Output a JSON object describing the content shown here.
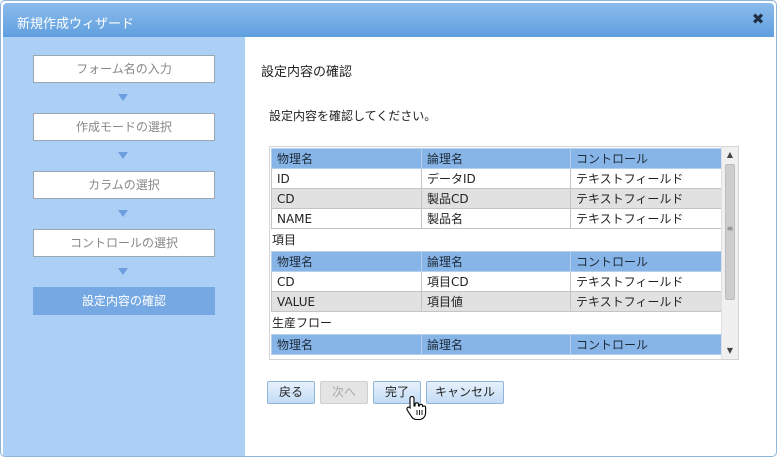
{
  "dialog": {
    "title": "新規作成ウィザード",
    "close_glyph": "✖"
  },
  "steps": [
    {
      "label": "フォーム名の入力",
      "active": false
    },
    {
      "label": "作成モードの選択",
      "active": false
    },
    {
      "label": "カラムの選択",
      "active": false
    },
    {
      "label": "コントロールの選択",
      "active": false
    },
    {
      "label": "設定内容の確認",
      "active": true
    }
  ],
  "main": {
    "heading": "設定内容の確認",
    "instruction": "設定内容を確認してください。"
  },
  "columns": [
    "物理名",
    "論理名",
    "コントロール"
  ],
  "groups": [
    {
      "label": "",
      "rows": [
        [
          "ID",
          "データID",
          "テキストフィールド"
        ],
        [
          "CD",
          "製品CD",
          "テキストフィールド"
        ],
        [
          "NAME",
          "製品名",
          "テキストフィールド"
        ]
      ]
    },
    {
      "label": "項目",
      "rows": [
        [
          "CD",
          "項目CD",
          "テキストフィールド"
        ],
        [
          "VALUE",
          "項目値",
          "テキストフィールド"
        ]
      ]
    },
    {
      "label": "生産フロー",
      "rows": []
    }
  ],
  "scrollbar": {
    "up_glyph": "▲",
    "down_glyph": "▼",
    "grip_glyph": "≡"
  },
  "buttons": {
    "back": {
      "label": "戻る",
      "enabled": true
    },
    "next": {
      "label": "次へ",
      "enabled": false
    },
    "finish": {
      "label": "完了",
      "enabled": true
    },
    "cancel": {
      "label": "キャンセル",
      "enabled": true
    }
  },
  "colors": {
    "titlebar": "#6ea8e6",
    "sidebar": "#acd0f5",
    "active_step": "#76a9e3",
    "table_header": "#87b5e8",
    "alt_row": "#e1e1e1"
  },
  "icons": {
    "close": "close-icon",
    "step_arrow": "arrow-down-icon",
    "cursor": "hand-pointer-icon"
  }
}
